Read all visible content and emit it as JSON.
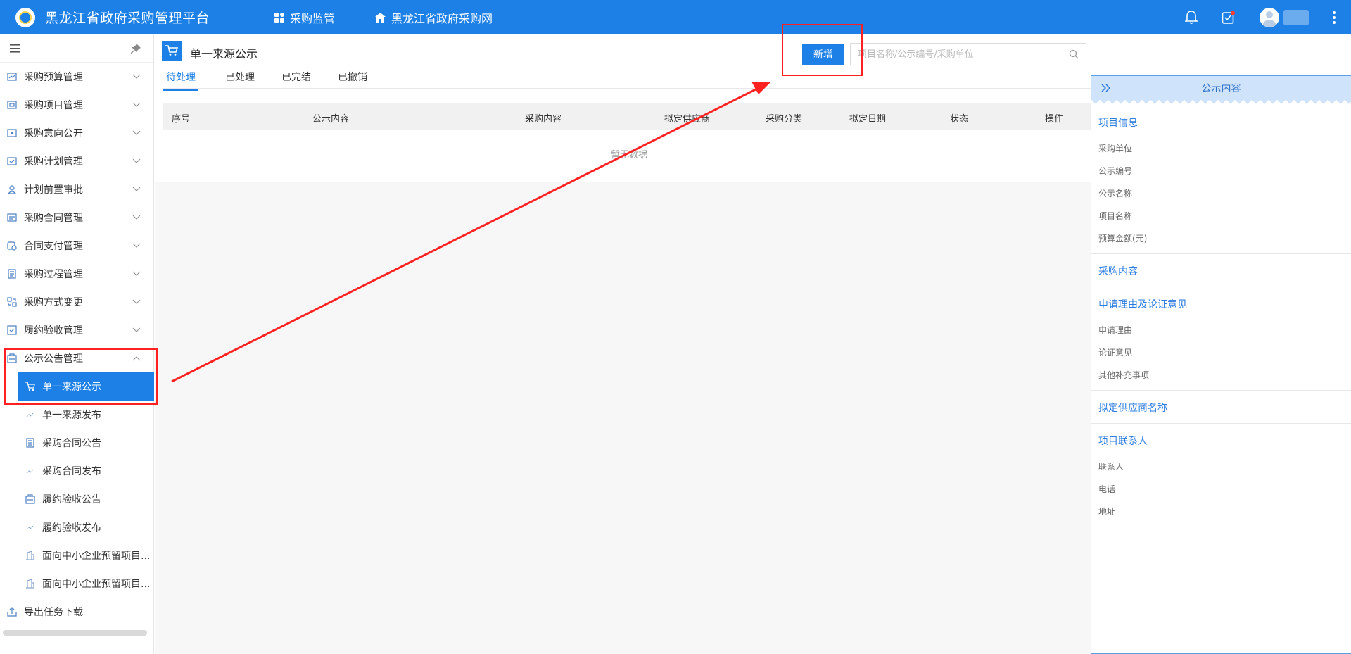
{
  "header": {
    "app_title": "黑龙江省政府采购管理平台",
    "nav": [
      {
        "label": "采购监管",
        "icon": "grid-icon"
      },
      {
        "label": "黑龙江省政府采购网",
        "icon": "home-icon"
      }
    ],
    "icons": [
      "bell-icon",
      "task-check-icon",
      "user-avatar-icon",
      "more-vertical-icon"
    ],
    "colors": {
      "primary": "#1c80e6",
      "highlight": "#ff2020"
    }
  },
  "sidebar": {
    "items": [
      {
        "label": "采购预算管理",
        "icon": "budget-icon"
      },
      {
        "label": "采购项目管理",
        "icon": "project-icon"
      },
      {
        "label": "采购意向公开",
        "icon": "intent-icon"
      },
      {
        "label": "采购计划管理",
        "icon": "plan-icon"
      },
      {
        "label": "计划前置审批",
        "icon": "approval-icon"
      },
      {
        "label": "采购合同管理",
        "icon": "contract-icon"
      },
      {
        "label": "合同支付管理",
        "icon": "payment-icon"
      },
      {
        "label": "采购过程管理",
        "icon": "process-icon"
      },
      {
        "label": "采购方式变更",
        "icon": "method-change-icon"
      },
      {
        "label": "履约验收管理",
        "icon": "acceptance-icon"
      },
      {
        "label": "公示公告管理",
        "icon": "notice-icon"
      }
    ],
    "sub_items": [
      {
        "label": "单一来源公示",
        "icon": "cart-icon",
        "active": true
      },
      {
        "label": "单一来源发布",
        "icon": "publish-icon"
      },
      {
        "label": "采购合同公告",
        "icon": "document-icon"
      },
      {
        "label": "采购合同发布",
        "icon": "publish-icon"
      },
      {
        "label": "履约验收公告",
        "icon": "notice-icon"
      },
      {
        "label": "履约验收发布",
        "icon": "publish-icon"
      },
      {
        "label": "面向中小企业预留项目...",
        "icon": "building-icon"
      },
      {
        "label": "面向中小企业预留项目...",
        "icon": "building-icon"
      }
    ],
    "export": {
      "label": "导出任务下载",
      "icon": "export-icon"
    }
  },
  "main": {
    "page_title": "单一来源公示",
    "new_button": "新增",
    "search_placeholder": "项目名称/公示编号/采购单位",
    "tabs": [
      {
        "label": "待处理",
        "active": true
      },
      {
        "label": "已处理"
      },
      {
        "label": "已完结"
      },
      {
        "label": "已撤销"
      }
    ],
    "table": {
      "columns": [
        "序号",
        "公示内容",
        "采购内容",
        "拟定供应商",
        "采购分类",
        "拟定日期",
        "状态",
        "操作"
      ],
      "rows": [],
      "empty_text": "暂无数据"
    }
  },
  "right_panel": {
    "title": "公示内容",
    "sections": [
      {
        "title": "项目信息",
        "fields": [
          "采购单位",
          "公示编号",
          "公示名称",
          "项目名称",
          "预算金额(元)"
        ]
      },
      {
        "title": "采购内容",
        "fields": []
      },
      {
        "title": "申请理由及论证意见",
        "fields": [
          "申请理由",
          "论证意见",
          "其他补充事项"
        ]
      },
      {
        "title": "拟定供应商名称",
        "fields": []
      },
      {
        "title": "项目联系人",
        "fields": [
          "联系人",
          "电话",
          "地址"
        ]
      }
    ]
  }
}
